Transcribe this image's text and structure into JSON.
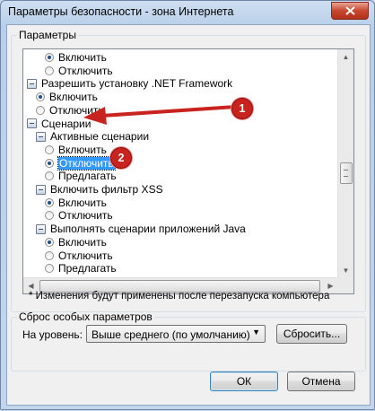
{
  "window": {
    "title": "Параметры безопасности - зона Интернета"
  },
  "settings": {
    "group_label": "Параметры",
    "tree": [
      {
        "kind": "radio",
        "label": "Включить",
        "checked": true,
        "indent": 2
      },
      {
        "kind": "radio",
        "label": "Отключить",
        "checked": false,
        "indent": 2
      },
      {
        "kind": "node",
        "label": "Разрешить установку .NET Framework",
        "indent": 0
      },
      {
        "kind": "radio",
        "label": "Включить",
        "checked": true,
        "indent": 1
      },
      {
        "kind": "radio",
        "label": "Отключить",
        "checked": false,
        "indent": 1
      },
      {
        "kind": "node",
        "label": "Сценарии",
        "indent": 0
      },
      {
        "kind": "node",
        "label": "Активные сценарии",
        "indent": 1
      },
      {
        "kind": "radio",
        "label": "Включить",
        "checked": false,
        "indent": 2
      },
      {
        "kind": "radio",
        "label": "Отключить",
        "checked": true,
        "selected": true,
        "indent": 2
      },
      {
        "kind": "radio",
        "label": "Предлагать",
        "checked": false,
        "indent": 2
      },
      {
        "kind": "node",
        "label": "Включить фильтр XSS",
        "indent": 1
      },
      {
        "kind": "radio",
        "label": "Включить",
        "checked": true,
        "indent": 2
      },
      {
        "kind": "radio",
        "label": "Отключить",
        "checked": false,
        "indent": 2
      },
      {
        "kind": "node",
        "label": "Выполнять сценарии приложений Java",
        "indent": 1
      },
      {
        "kind": "radio",
        "label": "Включить",
        "checked": true,
        "indent": 2
      },
      {
        "kind": "radio",
        "label": "Отключить",
        "checked": false,
        "indent": 2
      },
      {
        "kind": "radio",
        "label": "Предлагать",
        "checked": false,
        "indent": 2
      }
    ],
    "note": "* Изменения будут применены после перезапуска компьютера"
  },
  "reset": {
    "group_label": "Сброс особых параметров",
    "level_label": "На уровень:",
    "level_value": "Выше среднего (по умолчанию)",
    "reset_button": "Сбросить..."
  },
  "buttons": {
    "ok": "ОК",
    "cancel": "Отмена"
  },
  "annotations": {
    "badge1": "1",
    "badge2": "2",
    "color": "#c8231e"
  }
}
